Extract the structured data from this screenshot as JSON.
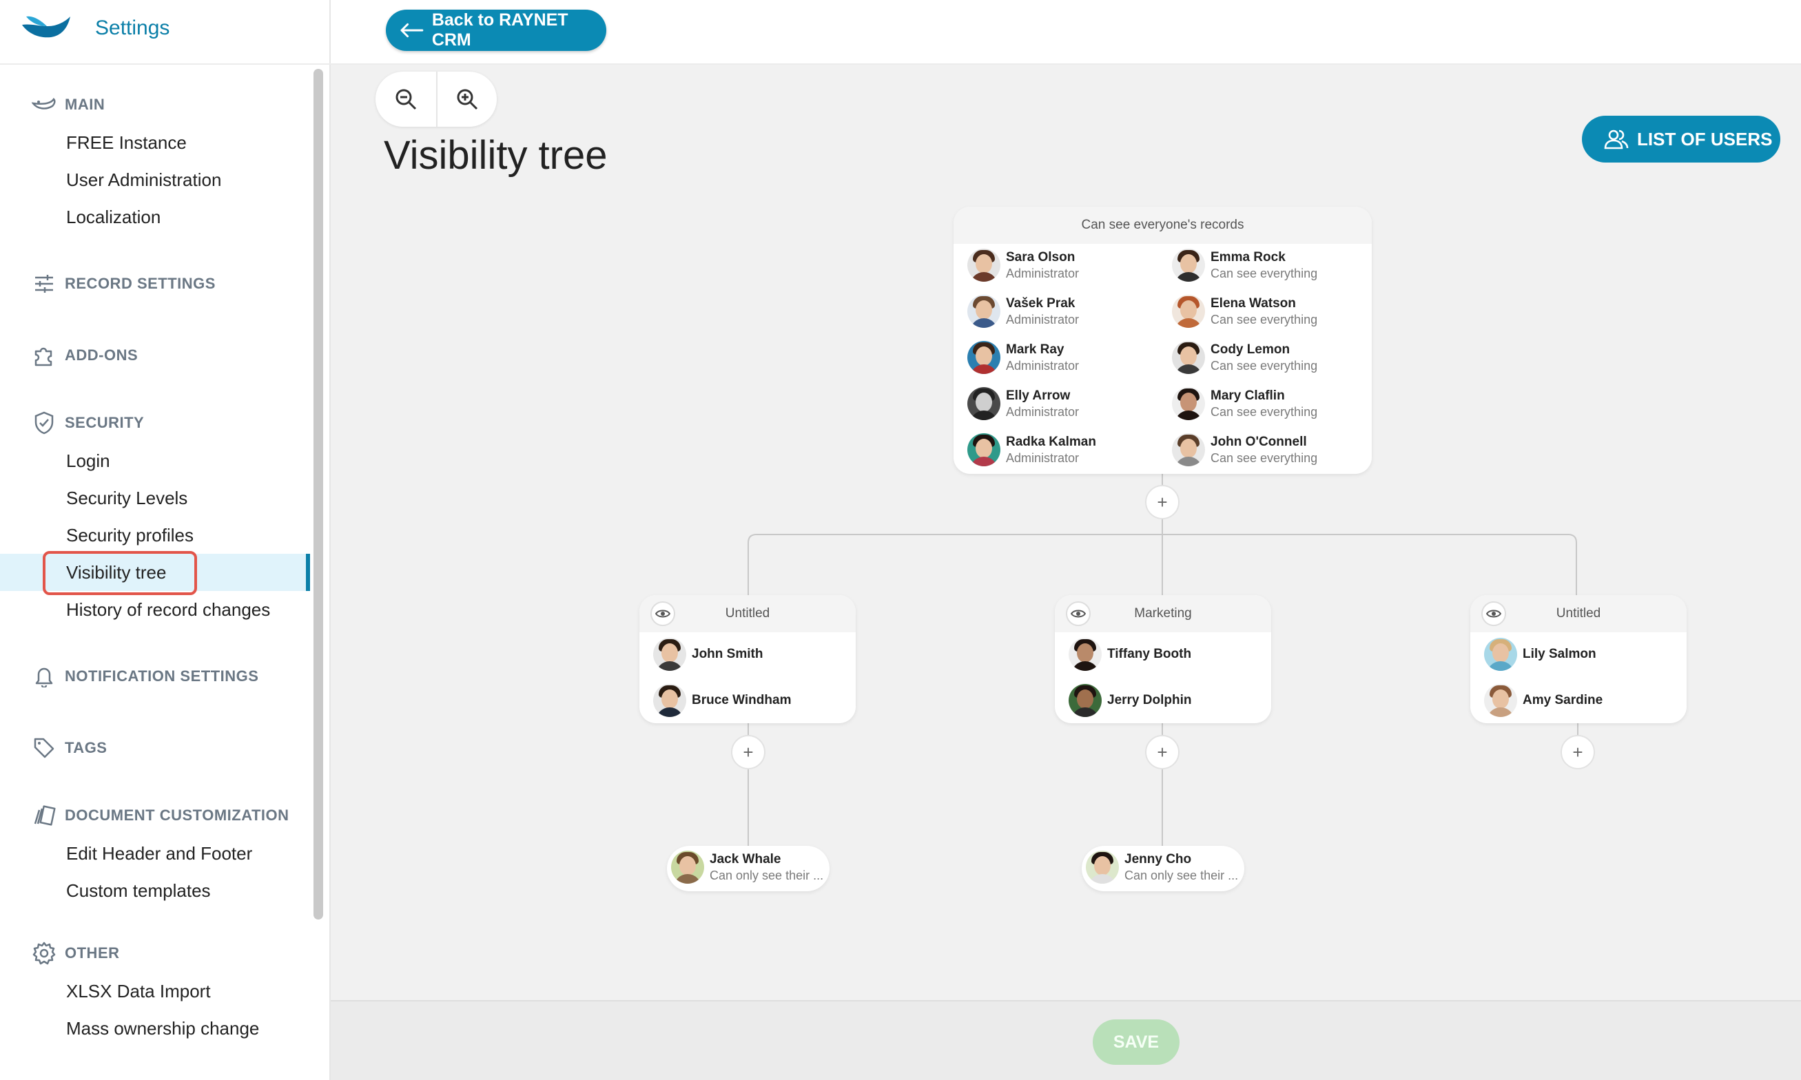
{
  "brand": {
    "title": "Settings"
  },
  "topbar": {
    "back_label": "Back to RAYNET CRM"
  },
  "page": {
    "title": "Visibility tree",
    "list_users_label": "LIST OF USERS",
    "save_label": "SAVE"
  },
  "sidebar": {
    "sections": [
      {
        "label": "MAIN",
        "icon": "whale-icon",
        "items": [
          "FREE Instance",
          "User Administration",
          "Localization"
        ]
      },
      {
        "label": "RECORD SETTINGS",
        "icon": "sliders-icon",
        "items": []
      },
      {
        "label": "ADD-ONS",
        "icon": "puzzle-icon",
        "items": []
      },
      {
        "label": "SECURITY",
        "icon": "shield-icon",
        "items": [
          "Login",
          "Security Levels",
          "Security profiles",
          "Visibility tree",
          "History of record changes"
        ]
      },
      {
        "label": "NOTIFICATION SETTINGS",
        "icon": "bell-icon",
        "items": []
      },
      {
        "label": "TAGS",
        "icon": "tag-icon",
        "items": []
      },
      {
        "label": "DOCUMENT CUSTOMIZATION",
        "icon": "documents-icon",
        "items": [
          "Edit Header and Footer",
          "Custom templates"
        ]
      },
      {
        "label": "OTHER",
        "icon": "gear-icon",
        "items": [
          "XLSX Data Import",
          "Mass ownership change"
        ]
      }
    ],
    "active_item": "Visibility tree"
  },
  "tree": {
    "root": {
      "title": "Can see everyone's records",
      "people": [
        {
          "name": "Sara Olson",
          "role": "Administrator"
        },
        {
          "name": "Emma Rock",
          "role": "Can see everything"
        },
        {
          "name": "Vašek Prak",
          "role": "Administrator"
        },
        {
          "name": "Elena Watson",
          "role": "Can see everything"
        },
        {
          "name": "Mark Ray",
          "role": "Administrator"
        },
        {
          "name": "Cody Lemon",
          "role": "Can see everything"
        },
        {
          "name": "Elly Arrow",
          "role": "Administrator"
        },
        {
          "name": "Mary Claflin",
          "role": "Can see everything"
        },
        {
          "name": "Radka Kalman",
          "role": "Administrator"
        },
        {
          "name": "John O'Connell",
          "role": "Can see everything"
        }
      ]
    },
    "groups": [
      {
        "title": "Untitled",
        "people": [
          "John Smith",
          "Bruce Windham"
        ],
        "leaf": {
          "name": "Jack Whale",
          "role": "Can only see their ..."
        }
      },
      {
        "title": "Marketing",
        "people": [
          "Tiffany Booth",
          "Jerry Dolphin"
        ],
        "leaf": {
          "name": "Jenny Cho",
          "role": "Can only see their ..."
        }
      },
      {
        "title": "Untitled",
        "people": [
          "Lily Salmon",
          "Amy Sardine"
        ],
        "leaf": null
      }
    ],
    "plus_symbol": "+"
  },
  "colors": {
    "accent": "#0b8ab4",
    "active_bg": "#e0f3fb",
    "highlight": "#e2554a",
    "save_disabled": "#b9e0b9"
  }
}
